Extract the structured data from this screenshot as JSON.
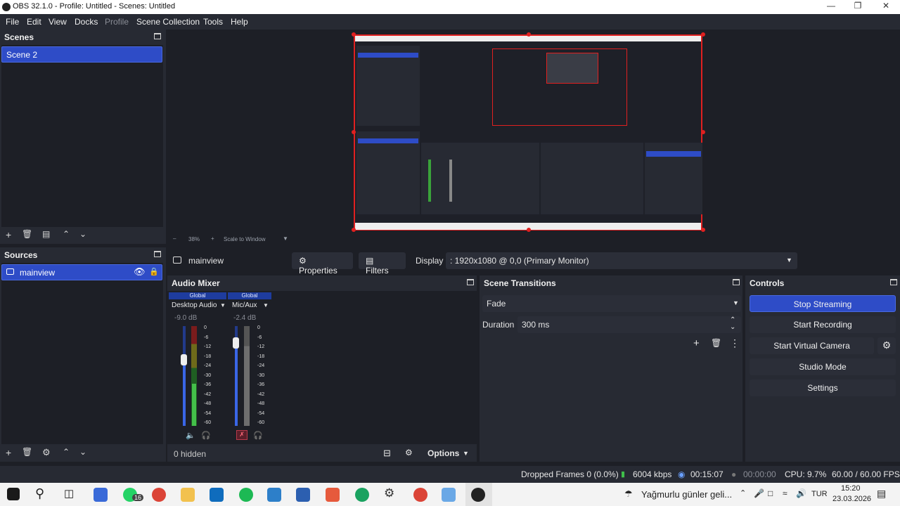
{
  "window": {
    "title": "OBS 32.1.0 - Profile: Untitled - Scenes: Untitled"
  },
  "menu": [
    "File",
    "Edit",
    "View",
    "Docks",
    "Profile",
    "Scene Collection",
    "Tools",
    "Help"
  ],
  "scenes": {
    "title": "Scenes",
    "items": [
      "Scene 2"
    ]
  },
  "sources": {
    "title": "Sources",
    "items": [
      "mainview"
    ]
  },
  "preview": {
    "zoom": "38%",
    "zoom_mode": "Scale to Window"
  },
  "source_toolbar": {
    "source_name": "mainview",
    "properties_label": "Properties",
    "filters_label": "Filters",
    "display_label": "Display",
    "display_value": ": 1920x1080 @ 0,0 (Primary Monitor)"
  },
  "audio_mixer": {
    "title": "Audio Mixer",
    "channels": [
      {
        "tag": "Global",
        "name": "Desktop Audio",
        "db": "-9.0 dB"
      },
      {
        "tag": "Global",
        "name": "Mic/Aux",
        "db": "-2.4 dB"
      }
    ],
    "scale": [
      "0",
      "-6",
      "-12",
      "-18",
      "-24",
      "-30",
      "-36",
      "-42",
      "-48",
      "-54",
      "-60"
    ],
    "hidden_label": "0 hidden",
    "options_label": "Options"
  },
  "scene_transitions": {
    "title": "Scene Transitions",
    "transition": "Fade",
    "duration_label": "Duration",
    "duration_value": "300 ms"
  },
  "controls": {
    "title": "Controls",
    "stop_streaming": "Stop Streaming",
    "start_recording": "Start Recording",
    "start_virtual_camera": "Start Virtual Camera",
    "studio_mode": "Studio Mode",
    "settings": "Settings"
  },
  "status": {
    "dropped_frames": "Dropped Frames 0 (0.0%)",
    "bitrate": "6004 kbps",
    "stream_time": "00:15:07",
    "record_time": "00:00:00",
    "cpu": "CPU: 9.7%",
    "fps": "60.00 / 60.00 FPS"
  },
  "taskbar": {
    "weather": "Yağmurlu günler geli...",
    "lang": "TUR",
    "time": "15:20",
    "date": "23.03.2026",
    "whatsapp_badge": "16"
  },
  "colors": {
    "accent": "#2e4cc7",
    "dock_bg": "#272a33",
    "app_bg": "#1d1f26",
    "record_red": "#e02020"
  }
}
